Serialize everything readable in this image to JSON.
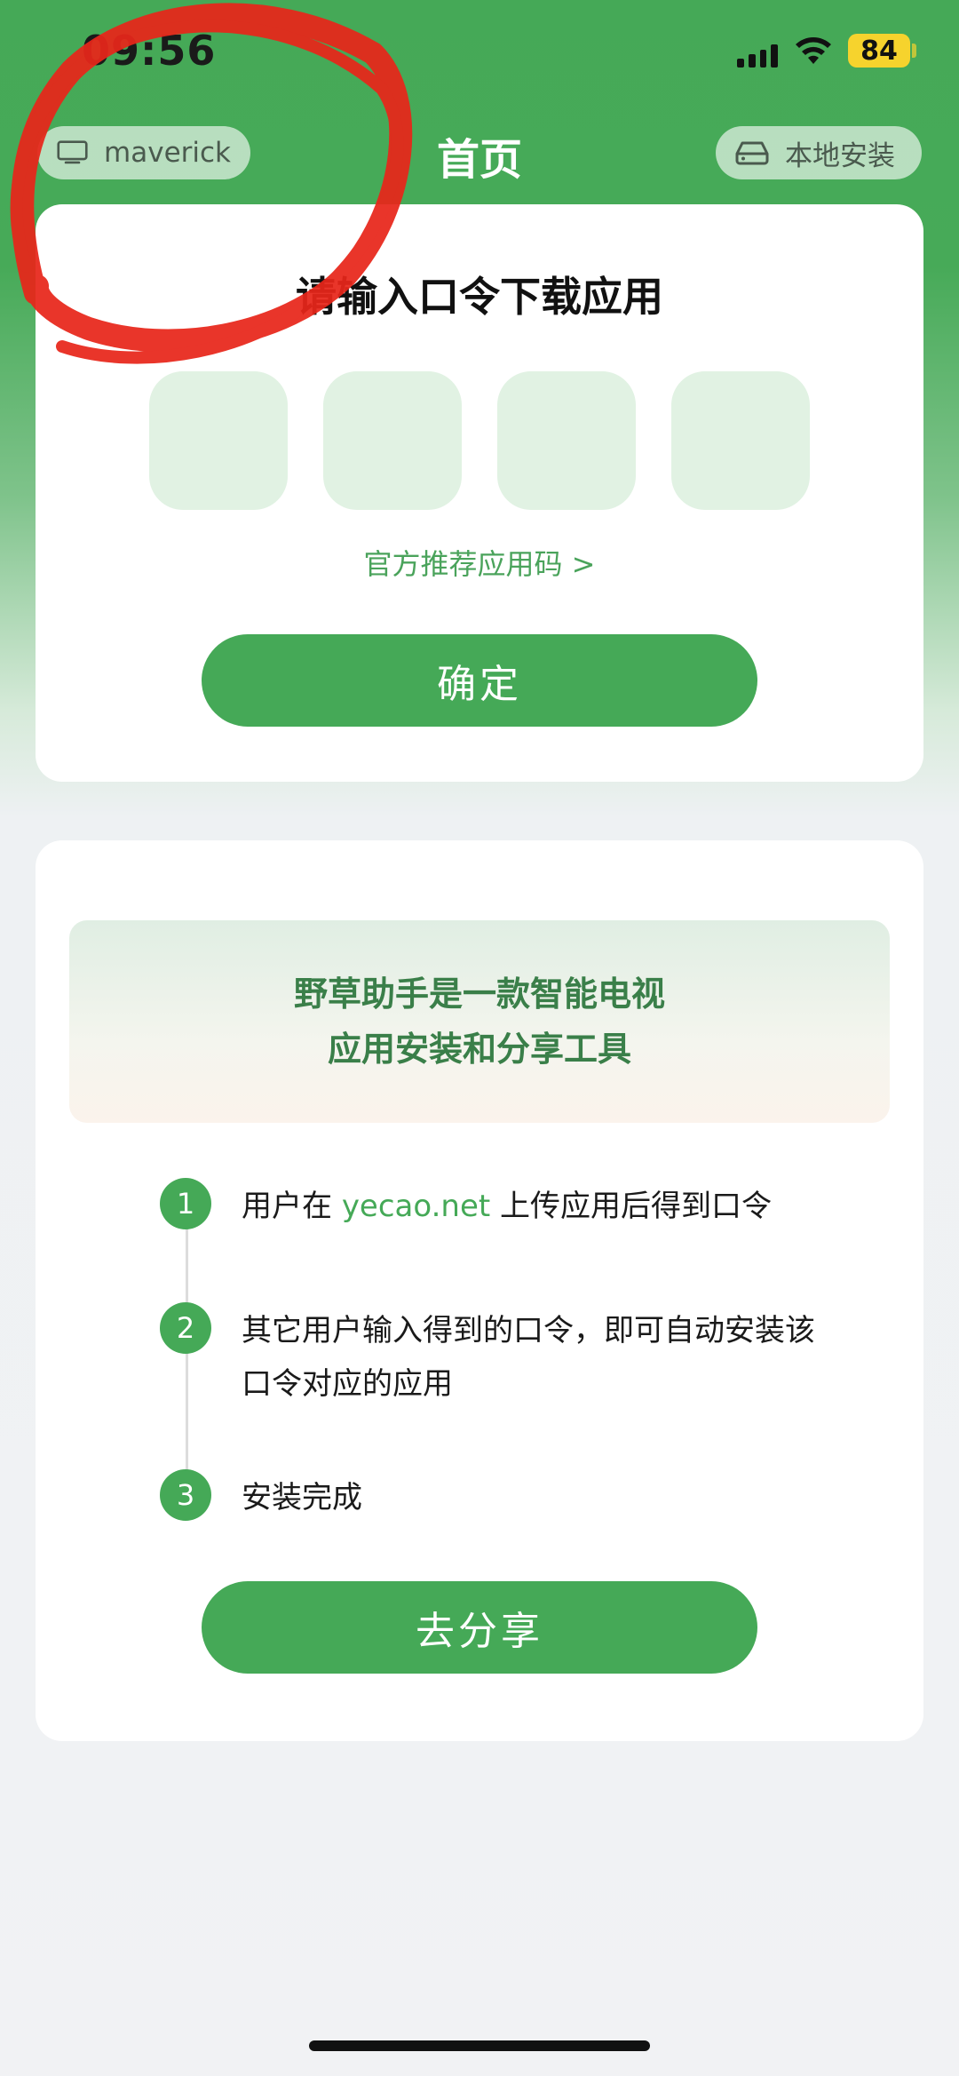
{
  "status_bar": {
    "time": "09:56",
    "battery": "84"
  },
  "nav": {
    "device_label": "maverick",
    "title": "首页",
    "local_install_label": "本地安装"
  },
  "code_card": {
    "title": "请输入口令下载应用",
    "recommend_link": "官方推荐应用码 >",
    "confirm_label": "确定"
  },
  "intro": {
    "line1": "野草助手是一款智能电视",
    "line2": "应用安装和分享工具"
  },
  "steps": [
    {
      "num": "1",
      "text_before": "用户在 ",
      "link": "yecao.net",
      "text_after": " 上传应用后得到口令"
    },
    {
      "num": "2",
      "text": "其它用户输入得到的口令，即可自动安装该口令对应的应用"
    },
    {
      "num": "3",
      "text": "安装完成"
    }
  ],
  "share_label": "去分享",
  "colors": {
    "accent": "#45a957",
    "highlight_text": "#3a7f49",
    "code_box": "#e1f2e3",
    "annotation_stroke": "#e8261a"
  },
  "icons": [
    "tv-icon",
    "storage-drive-icon",
    "signal-icon",
    "wifi-icon",
    "battery-icon"
  ]
}
